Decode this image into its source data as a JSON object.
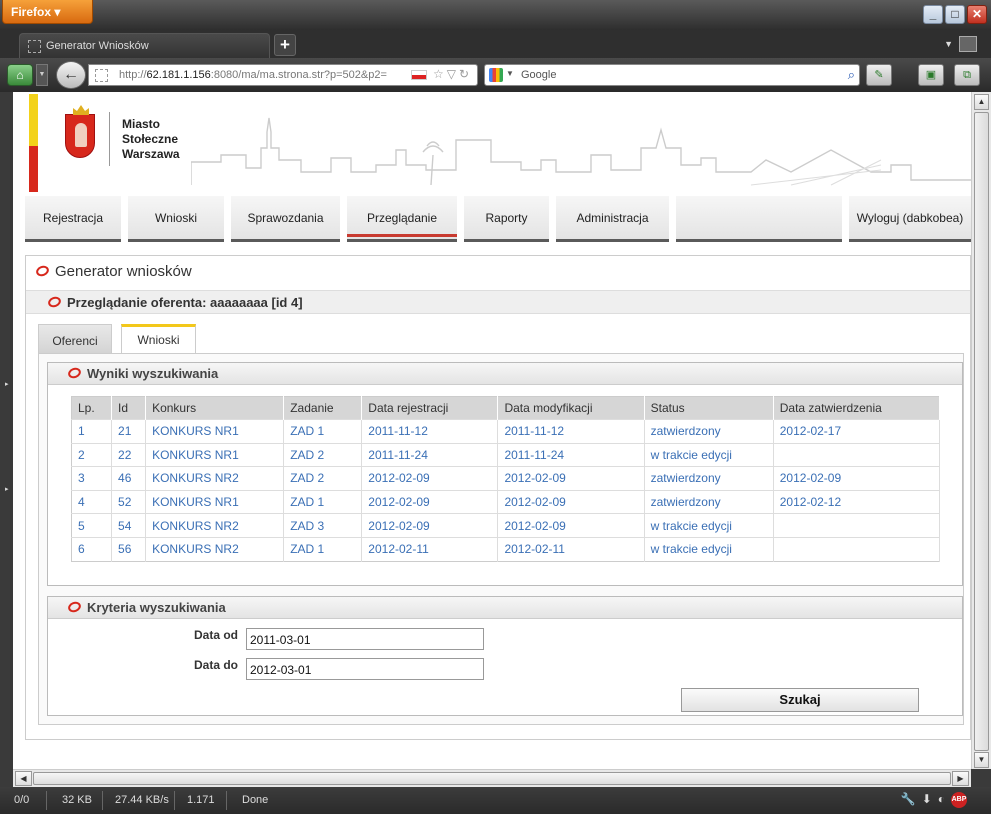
{
  "browser": {
    "app_button": "Firefox",
    "tab_title": "Generator Wniosków",
    "url_prefix": "http://",
    "url_host": "62.181.1.156",
    "url_rest": ":8080/ma/ma.strona.str?p=502&p2=",
    "search_placeholder": "Google",
    "window_controls": [
      "minimize",
      "maximize",
      "close"
    ]
  },
  "status_bar": {
    "count": "0/0",
    "size": "32 KB",
    "speed": "27.44 KB/s",
    "time": "1.171",
    "state": "Done"
  },
  "header": {
    "logo_line1": "Miasto",
    "logo_line2": "Stołeczne",
    "logo_line3": "Warszawa"
  },
  "menu": {
    "items": [
      "Rejestracja",
      "Wnioski",
      "Sprawozdania",
      "Przeglądanie",
      "Raporty",
      "Administracja",
      "",
      "Wyloguj (dabkobea)"
    ],
    "active": "Przeglądanie"
  },
  "panel": {
    "title": "Generator wniosków",
    "subtitle": "Przeglądanie oferenta: aaaaaaaa [id 4]",
    "tabs": [
      "Oferenci",
      "Wnioski"
    ],
    "active_tab": "Wnioski"
  },
  "results": {
    "title": "Wyniki wyszukiwania",
    "columns": [
      "Lp.",
      "Id",
      "Konkurs",
      "Zadanie",
      "Data rejestracji",
      "Data modyfikacji",
      "Status",
      "Data zatwierdzenia"
    ],
    "rows": [
      [
        "1",
        "21",
        "KONKURS NR1",
        "ZAD 1",
        "2011-11-12",
        "2011-11-12",
        "zatwierdzony",
        "2012-02-17"
      ],
      [
        "2",
        "22",
        "KONKURS NR1",
        "ZAD 2",
        "2011-11-24",
        "2011-11-24",
        "w trakcie edycji",
        ""
      ],
      [
        "3",
        "46",
        "KONKURS NR2",
        "ZAD 2",
        "2012-02-09",
        "2012-02-09",
        "zatwierdzony",
        "2012-02-09"
      ],
      [
        "4",
        "52",
        "KONKURS NR1",
        "ZAD 1",
        "2012-02-09",
        "2012-02-09",
        "zatwierdzony",
        "2012-02-12"
      ],
      [
        "5",
        "54",
        "KONKURS NR2",
        "ZAD 3",
        "2012-02-09",
        "2012-02-09",
        "w trakcie edycji",
        ""
      ],
      [
        "6",
        "56",
        "KONKURS NR2",
        "ZAD 1",
        "2012-02-11",
        "2012-02-11",
        "w trakcie edycji",
        ""
      ]
    ]
  },
  "criteria": {
    "title": "Kryteria wyszukiwania",
    "date_from_label": "Data od",
    "date_from_value": "2011-03-01",
    "date_to_label": "Data do",
    "date_to_value": "2012-03-01",
    "search_button": "Szukaj"
  },
  "colors": {
    "brand_red": "#d7281c",
    "brand_yellow": "#f3d21a",
    "link_blue": "#3a6fb5"
  }
}
